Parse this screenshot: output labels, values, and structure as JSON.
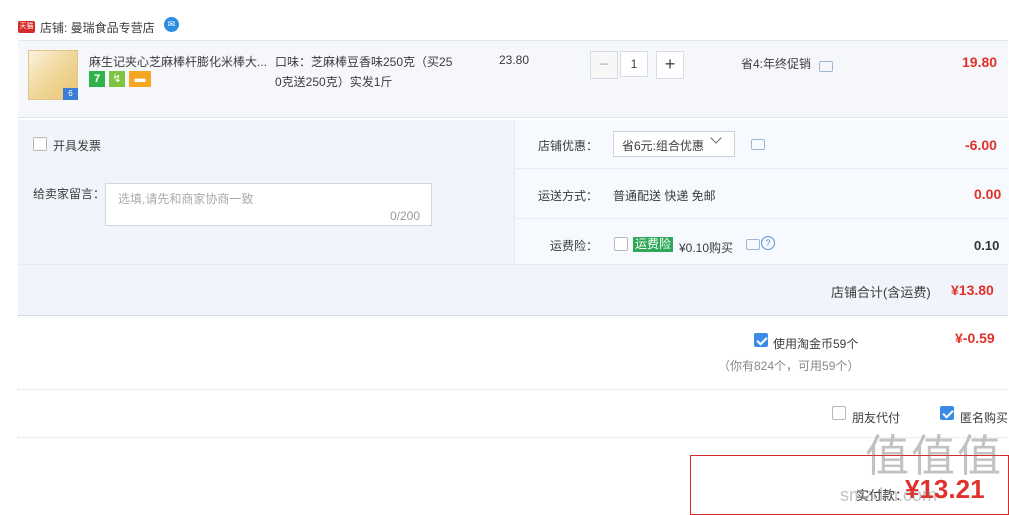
{
  "store": {
    "badge": "天猫",
    "label": "店铺: 曼瑞食品专营店"
  },
  "item": {
    "title": "麻生记夹心芝麻棒杆膨化米棒大...",
    "thumb_badge": "6",
    "services": [
      "7",
      "↯",
      "▬"
    ],
    "sku_line1": "口味：芝麻棒豆香味250克（买25",
    "sku_line2": "0克送250克）实发1斤",
    "price": "23.80",
    "qty_minus": "−",
    "qty_value": "1",
    "qty_plus": "+",
    "promo": "省4:年终促销",
    "subtotal": "19.80"
  },
  "invoice": {
    "label": "开具发票",
    "checked": false
  },
  "message": {
    "label": "给卖家留言：",
    "placeholder": "选填,请先和商家协商一致",
    "count": "0/200"
  },
  "store_discount": {
    "label": "店铺优惠：",
    "selected": "省6元:组合优惠",
    "value": "-6.00"
  },
  "shipping": {
    "label": "运送方式：",
    "method": "普通配送 快递 免邮",
    "value": "0.00"
  },
  "insurance": {
    "label": "运费险：",
    "tag": "运费险",
    "price_text": "¥0.10购买",
    "value": "0.10",
    "checked": false
  },
  "store_total": {
    "label": "店铺合计(含运费)",
    "value": "¥13.80"
  },
  "coins": {
    "label": "使用淘金币59个",
    "note": "（你有824个，可用59个）",
    "value": "¥-0.59",
    "checked": true
  },
  "pay_options": {
    "friend_pay": {
      "label": "朋友代付",
      "checked": false
    },
    "anonymous": {
      "label": "匿名购买",
      "checked": true
    }
  },
  "final": {
    "label": "实付款：",
    "value": "¥13.21"
  },
  "watermark": {
    "line1": "值值值",
    "line2": "smzdm.com"
  },
  "colors": {
    "accent_red": "#e0312a",
    "check_blue": "#3a8be6",
    "tmall_red": "#d62b2b"
  }
}
